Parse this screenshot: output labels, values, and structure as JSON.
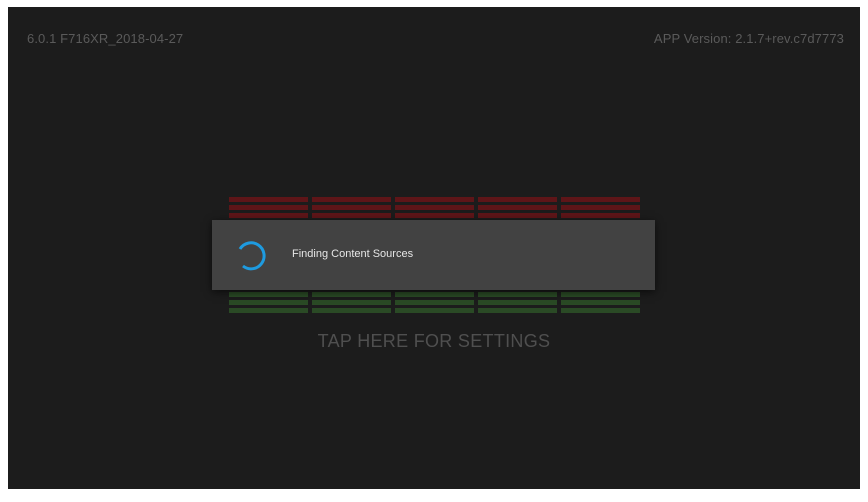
{
  "status_bar": {
    "build": "6.0.1 F716XR_2018-04-27",
    "app_version": "APP Version: 2.1.7+rev.c7d7773"
  },
  "meters": {
    "columns": 5,
    "red_color": "#5e1518",
    "green_color": "#2a4a25"
  },
  "settings": {
    "label": "TAP HERE FOR SETTINGS"
  },
  "dialog": {
    "message": "Finding Content Sources",
    "spinner_color": "#1e9be0",
    "icon": "loading-spinner-icon"
  }
}
